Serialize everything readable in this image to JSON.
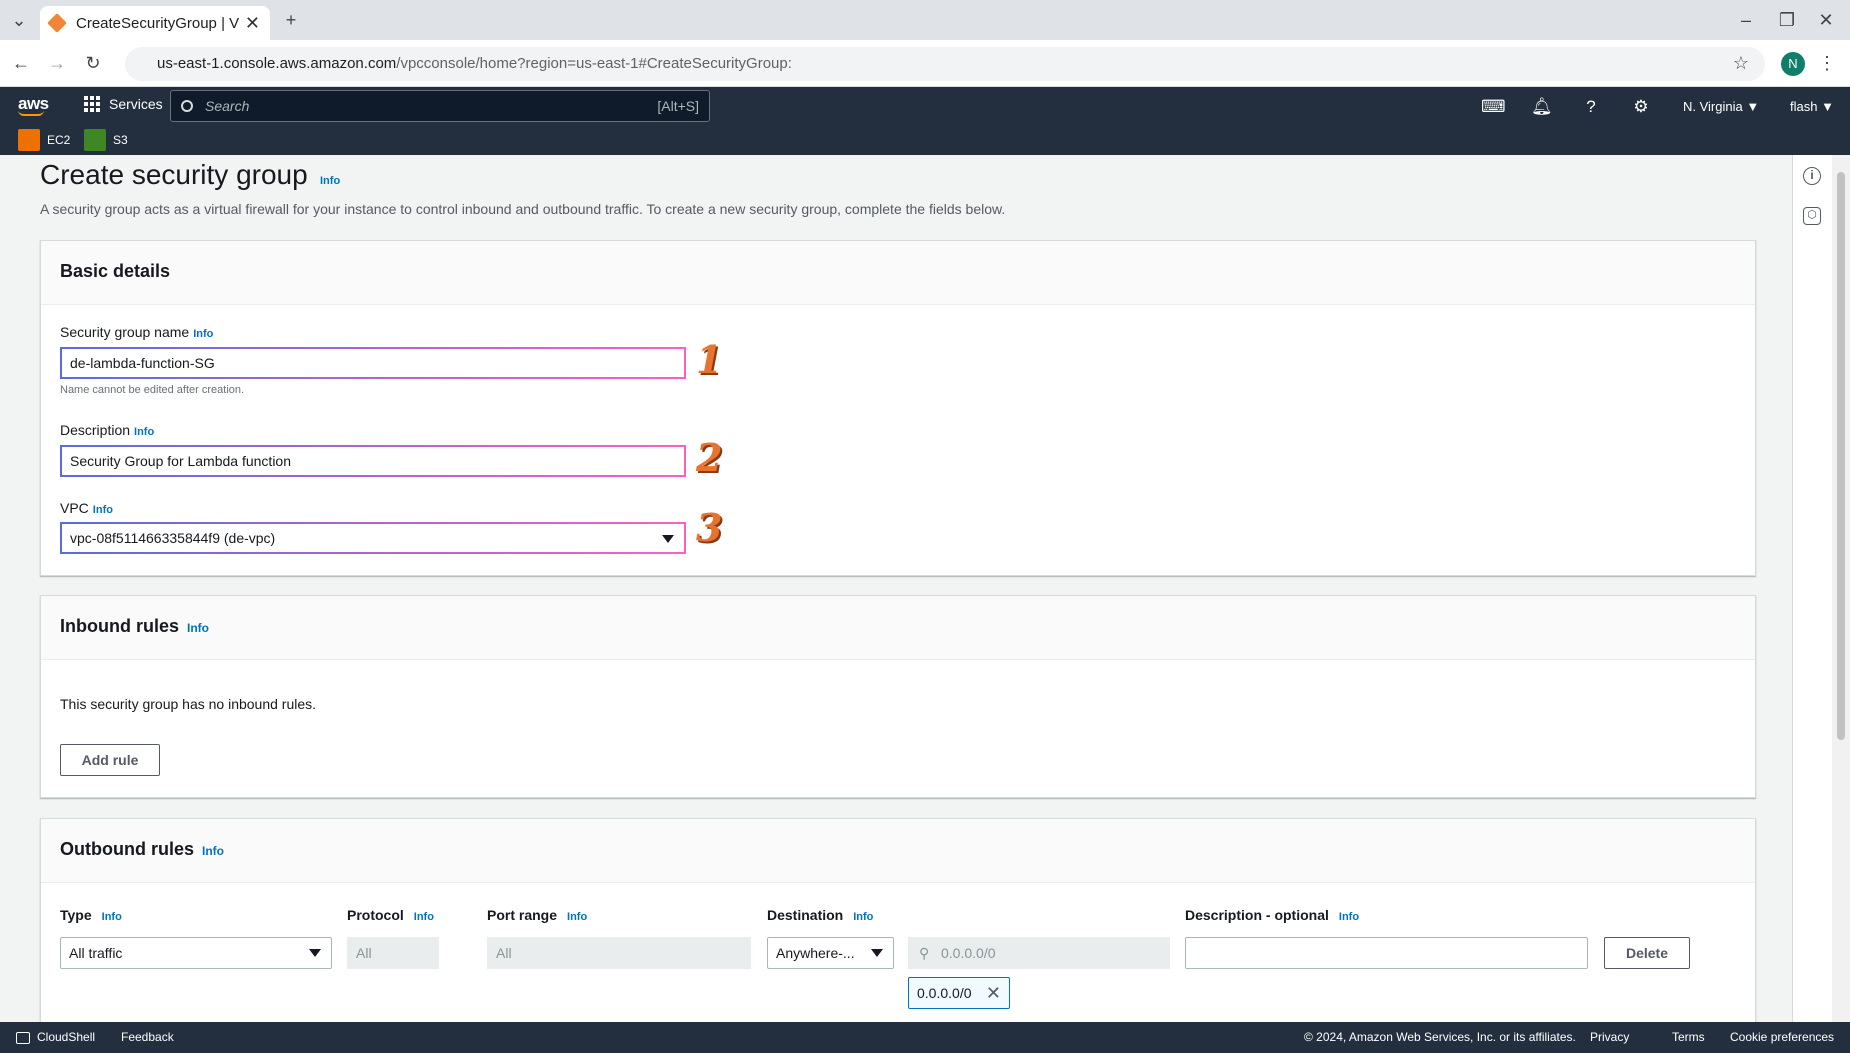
{
  "browser": {
    "tab_title": "CreateSecurityGroup | VPC",
    "url_host": "us-east-1.console.aws.amazon.com",
    "url_path": "/vpcconsole/home?region=us-east-1#CreateSecurityGroup:",
    "profile_initial": "N"
  },
  "aws_nav": {
    "logo": "aws",
    "services_label": "Services",
    "search_placeholder": "Search",
    "search_shortcut": "[Alt+S]",
    "region": "N. Virginia ▼",
    "user": "flash ▼",
    "favorites": [
      {
        "label": "EC2",
        "color": "#ed7100"
      },
      {
        "label": "S3",
        "color": "#3f8624"
      }
    ]
  },
  "page": {
    "title": "Create security group",
    "title_info": "Info",
    "description": "A security group acts as a virtual firewall for your instance to control inbound and outbound traffic. To create a new security group, complete the fields below."
  },
  "basic_details": {
    "heading": "Basic details",
    "name_label": "Security group name",
    "name_value": "de-lambda-function-SG",
    "name_hint": "Name cannot be edited after creation.",
    "desc_label": "Description",
    "desc_value": "Security Group for Lambda function",
    "vpc_label": "VPC",
    "vpc_value": "vpc-08f511466335844f9 (de-vpc)",
    "info": "Info",
    "markers": [
      "1",
      "2",
      "3"
    ]
  },
  "inbound": {
    "heading": "Inbound rules",
    "info": "Info",
    "empty_text": "This security group has no inbound rules.",
    "add_rule": "Add rule"
  },
  "outbound": {
    "heading": "Outbound rules",
    "info": "Info",
    "col_type": "Type",
    "col_protocol": "Protocol",
    "col_port": "Port range",
    "col_destination": "Destination",
    "col_description": "Description - optional",
    "type_value": "All traffic",
    "protocol_value": "All",
    "port_value": "All",
    "destination_value": "Anywhere-...",
    "cidr_placeholder": "0.0.0.0/0",
    "cidr_token": "0.0.0.0/0",
    "delete": "Delete"
  },
  "footer": {
    "cloudshell": "CloudShell",
    "feedback": "Feedback",
    "copyright": "© 2024, Amazon Web Services, Inc. or its affiliates.",
    "privacy": "Privacy",
    "terms": "Terms",
    "cookies": "Cookie preferences"
  }
}
